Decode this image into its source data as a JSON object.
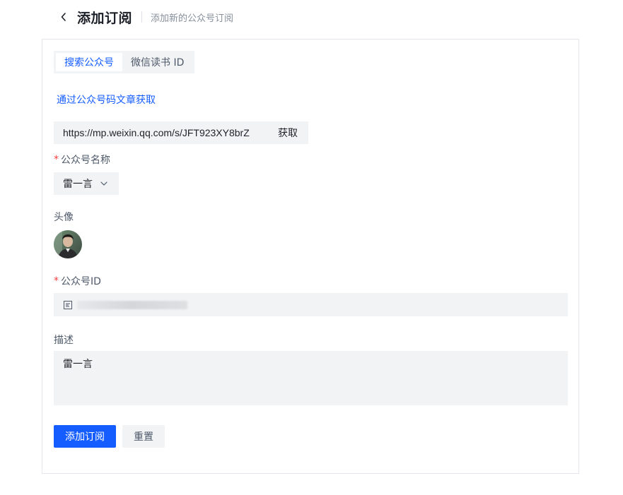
{
  "header": {
    "title": "添加订阅",
    "subtitle": "添加新的公众号订阅"
  },
  "tabs": [
    {
      "label": "搜索公众号",
      "active": true
    },
    {
      "label": "微信读书 ID",
      "active": false
    }
  ],
  "url_fetch": {
    "link_text": "通过公众号码文章获取",
    "url_value": "https://mp.weixin.qq.com/s/JFT923XY8brZ",
    "fetch_label": "获取"
  },
  "form": {
    "name_label": "公众号名称",
    "name_value": "雷一言",
    "avatar_label": "头像",
    "id_label": "公众号ID",
    "desc_label": "描述",
    "desc_value": "雷一言",
    "required_mark": "*"
  },
  "actions": {
    "submit_label": "添加订阅",
    "reset_label": "重置"
  },
  "colors": {
    "primary": "#165dff",
    "required": "#f53f3f",
    "input_bg": "#f2f3f5"
  }
}
